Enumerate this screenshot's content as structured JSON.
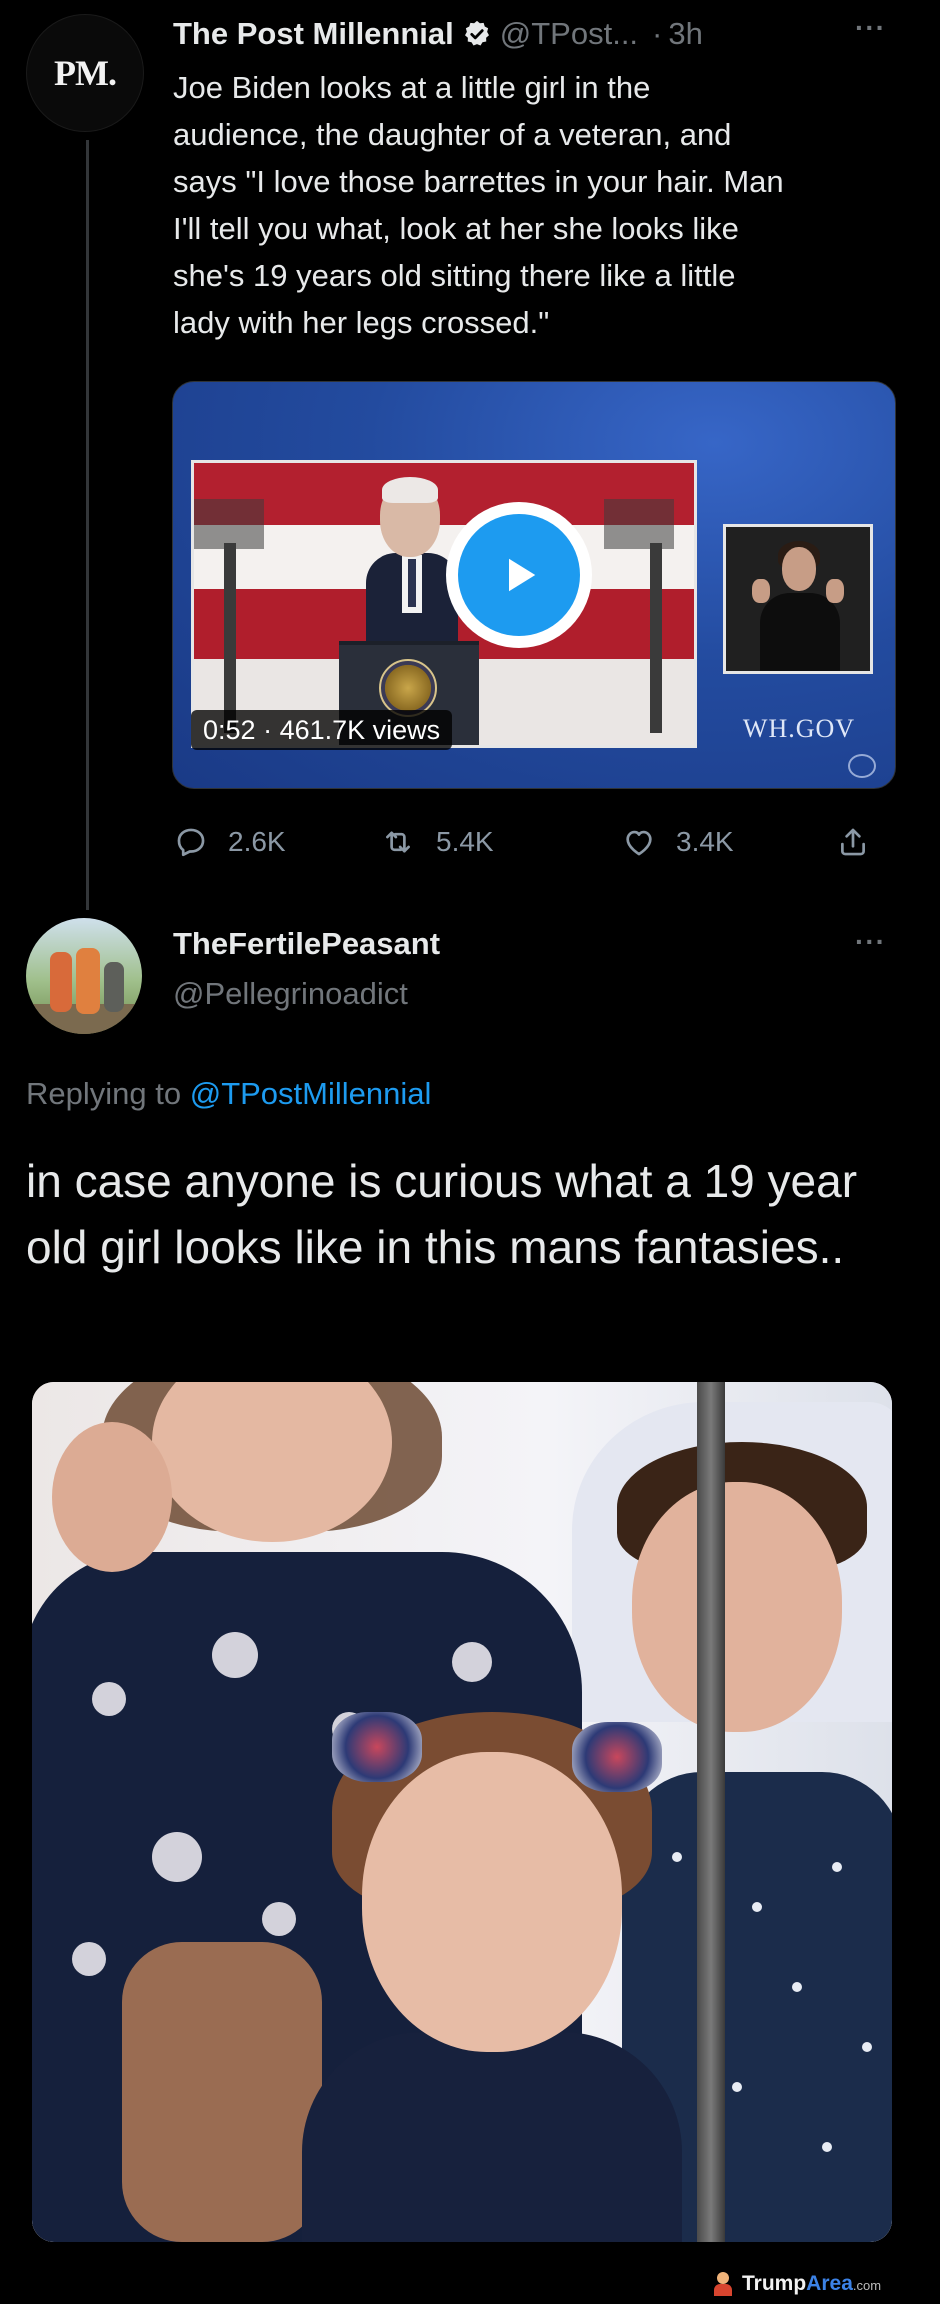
{
  "tweet": {
    "avatar_text": "PM.",
    "author_name": "The Post Millennial",
    "handle": "@TPost...",
    "separator": "·",
    "time": "3h",
    "more": "···",
    "text": "Joe Biden looks at a little girl in the\naudience, the daughter of a veteran, and\nsays \"I love those barrettes in your hair. Man\nI'll tell you what, look at her she looks like\nshe's 19 years old sitting there like a little\nlady with her legs crossed.\"",
    "video": {
      "duration": "0:52",
      "views": "461.7K views",
      "source_label": "WH.GOV"
    },
    "actions": {
      "replies": "2.6K",
      "retweets": "5.4K",
      "likes": "3.4K"
    }
  },
  "reply": {
    "author_name": "TheFertilePeasant",
    "handle": "@Pellegrinoadict",
    "more": "···",
    "replying_prefix": "Replying to",
    "replying_to": "@TPostMillennial",
    "text": "in case anyone is curious what a 19 year old girl looks like in this mans fantasies.."
  },
  "watermark": {
    "brand_part1": "Trump",
    "brand_part2": "Area",
    "suffix": ".com"
  },
  "colors": {
    "background": "#000000",
    "text": "#e7e9ea",
    "muted": "#71767b",
    "accent": "#1d9bf0"
  },
  "icons": [
    "verified-badge-icon",
    "play-icon",
    "reply-icon",
    "retweet-icon",
    "like-icon",
    "share-icon",
    "more-icon"
  ]
}
